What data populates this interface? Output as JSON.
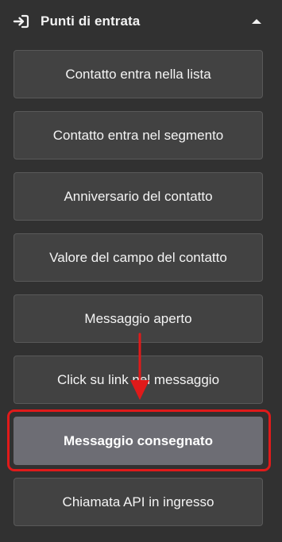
{
  "header": {
    "icon": "enter-arrow-icon",
    "title": "Punti di entrata",
    "collapse_icon": "caret-up-icon"
  },
  "entry_points": [
    {
      "label": "Contatto entra nella lista"
    },
    {
      "label": "Contatto entra nel segmento"
    },
    {
      "label": "Anniversario del contatto"
    },
    {
      "label": "Valore del campo del contatto"
    },
    {
      "label": "Messaggio aperto"
    },
    {
      "label": "Click su link nel messaggio"
    },
    {
      "label": "Messaggio consegnato",
      "highlighted": true
    },
    {
      "label": "Chiamata API in ingresso"
    }
  ],
  "colors": {
    "background": "#313131",
    "item_background": "#424242",
    "item_border": "#595959",
    "highlighted_item": "#6d6d74",
    "annotation_red": "#e01a1a"
  }
}
